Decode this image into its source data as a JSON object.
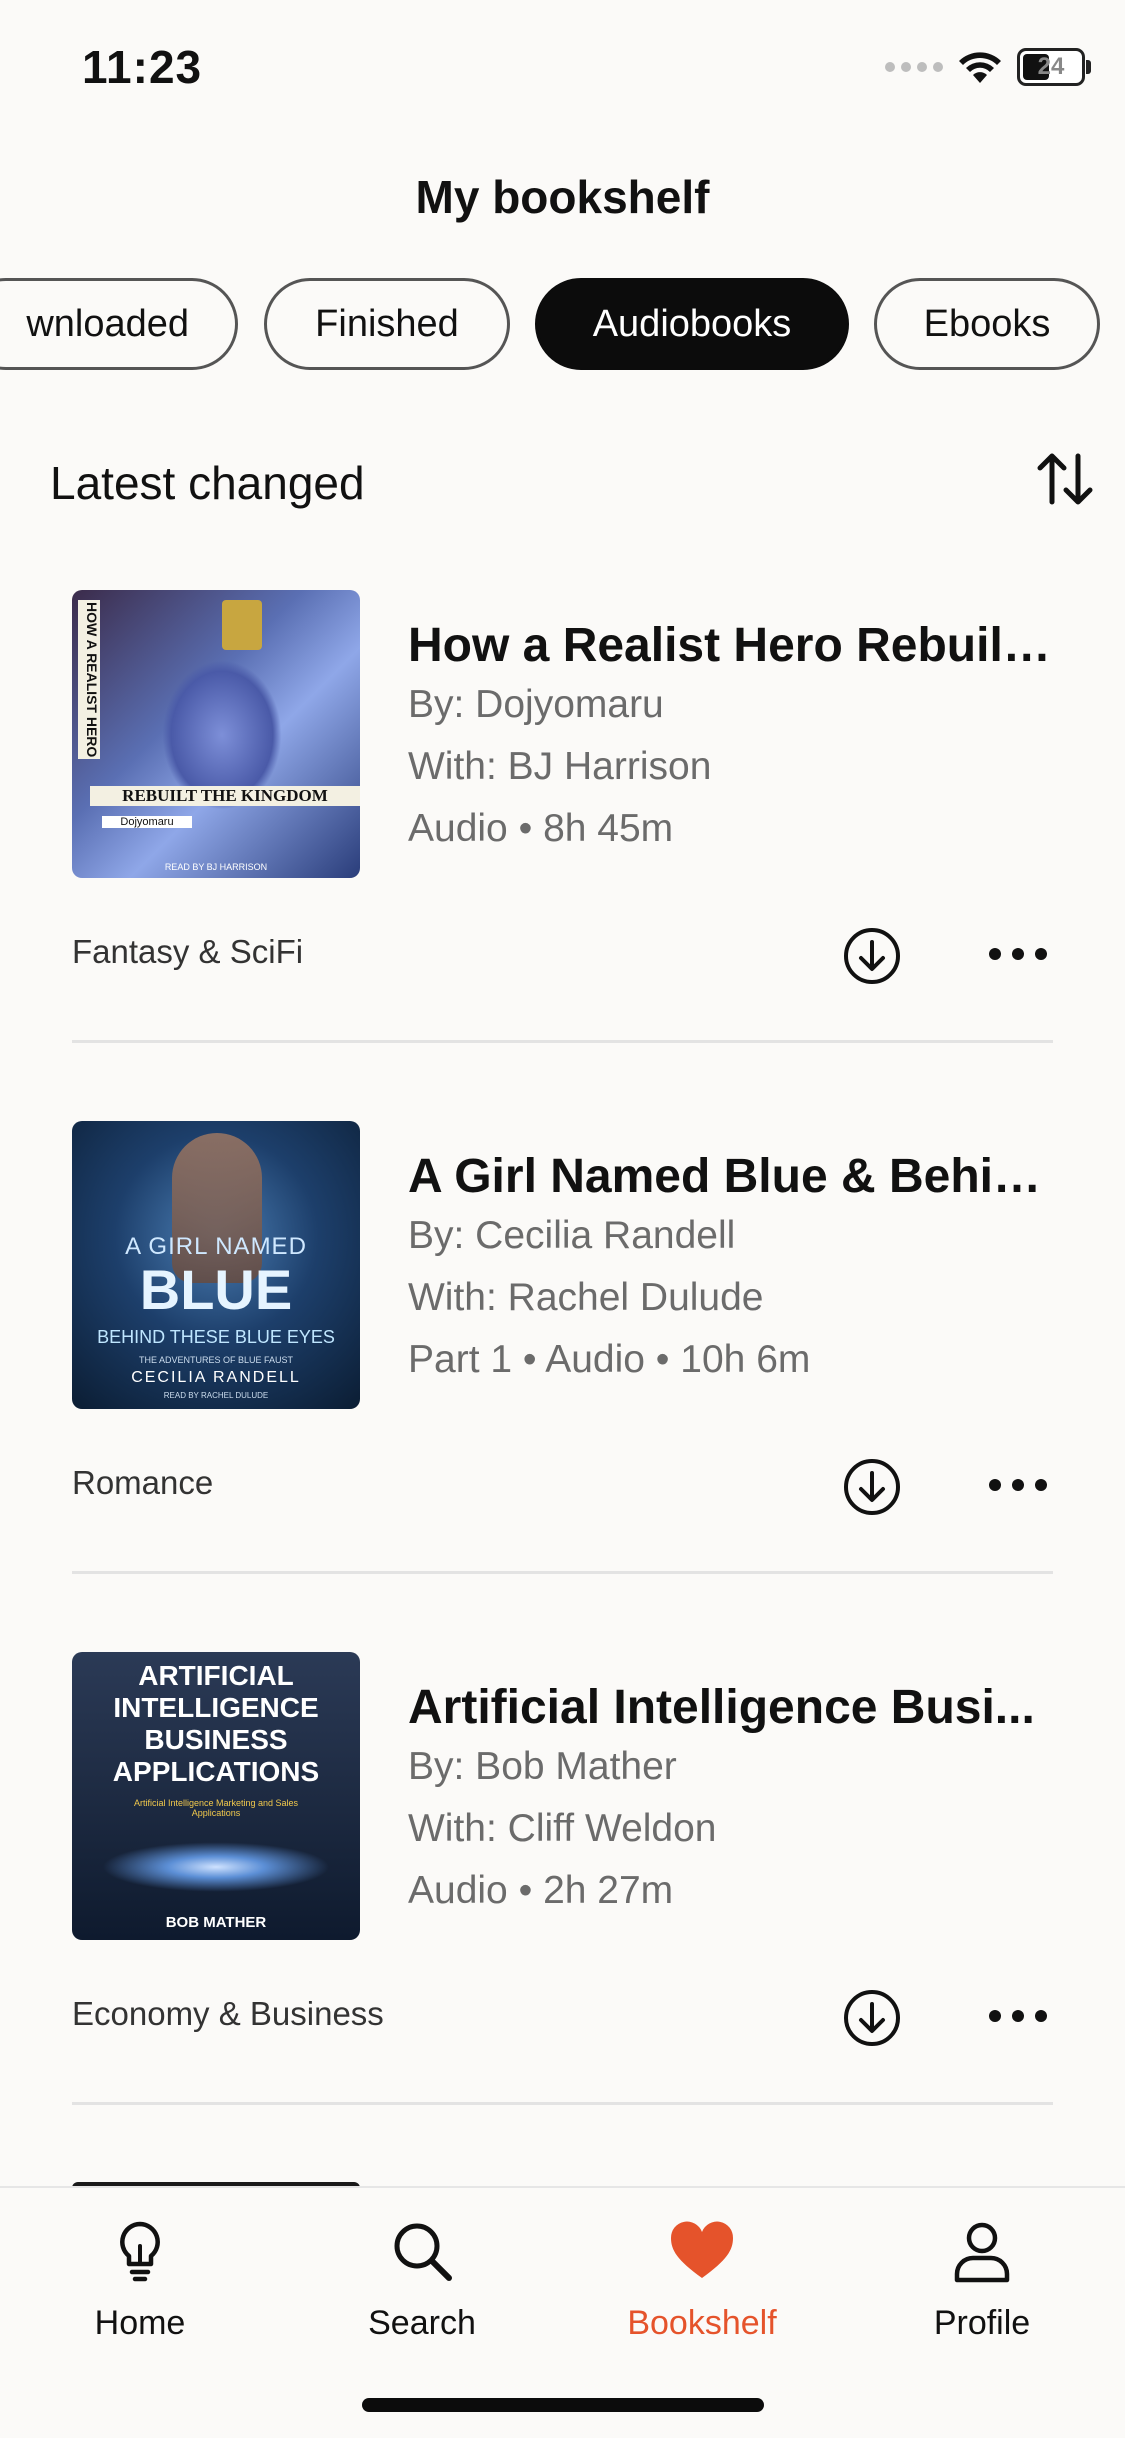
{
  "status": {
    "time": "11:23",
    "battery": "24"
  },
  "header": {
    "title": "My bookshelf"
  },
  "tabs": [
    {
      "label": "Downloaded",
      "visible_label": "wnloaded"
    },
    {
      "label": "Finished"
    },
    {
      "label": "Audiobooks",
      "active": true
    },
    {
      "label": "Ebooks"
    }
  ],
  "section": {
    "title": "Latest changed"
  },
  "books": [
    {
      "title": "How a Realist Hero Rebuilt...",
      "by": "By: Dojyomaru",
      "with": "With: BJ Harrison",
      "meta": "Audio • 8h 45m",
      "genre": "Fantasy & SciFi",
      "cover_text": {
        "main": "REBUILT THE KINGDOM",
        "side": "HOW A REALIST HERO",
        "author": "Dojyomaru",
        "reader": "READ BY BJ HARRISON"
      }
    },
    {
      "title": "A Girl Named Blue & Behin...",
      "by": "By: Cecilia Randell",
      "with": "With: Rachel Dulude",
      "meta": "Part 1 • Audio • 10h 6m",
      "genre": "Romance",
      "cover_text": {
        "line1": "A GIRL NAMED",
        "line2": "BLUE",
        "line3": "BEHIND THESE BLUE EYES",
        "series": "THE ADVENTURES OF BLUE FAUST",
        "author": "CECILIA RANDELL",
        "reader": "READ BY RACHEL DULUDE"
      }
    },
    {
      "title": "Artificial Intelligence Busi...",
      "by": "By: Bob Mather",
      "with": "With: Cliff Weldon",
      "meta": "Audio • 2h 27m",
      "genre": "Economy & Business",
      "cover_text": {
        "line1": "ARTIFICIAL",
        "line2": "INTELLIGENCE",
        "line3": "BUSINESS",
        "line4": "APPLICATIONS",
        "sub": "Artificial Intelligence Marketing and Sales Applications",
        "author": "BOB MATHER"
      }
    }
  ],
  "nav": [
    {
      "label": "Home",
      "icon": "lightbulb-icon"
    },
    {
      "label": "Search",
      "icon": "search-icon"
    },
    {
      "label": "Bookshelf",
      "icon": "heart-icon",
      "active": true
    },
    {
      "label": "Profile",
      "icon": "person-icon"
    }
  ],
  "colors": {
    "accent": "#e5532b",
    "active_tab": "#0c0c0c",
    "background": "#fbfaf8"
  }
}
